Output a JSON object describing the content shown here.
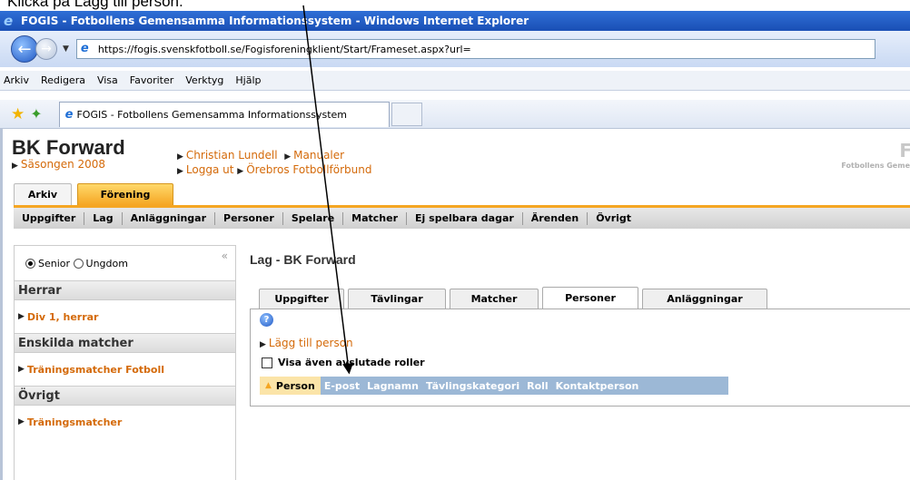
{
  "caption": "Klicka på Lägg till person.",
  "window": {
    "title": "FOGIS - Fotbollens Gemensamma Informationssystem - Windows Internet Explorer",
    "url": "https://fogis.svenskfotboll.se/Fogisforeningklient/Start/Frameset.aspx?url="
  },
  "menu": [
    "Arkiv",
    "Redigera",
    "Visa",
    "Favoriter",
    "Verktyg",
    "Hjälp"
  ],
  "browser_tab": {
    "title": "FOGIS - Fotbollens Gemensamma Informationssystem"
  },
  "header": {
    "org_name": "BK Forward",
    "season": "Säsongen 2008",
    "user": "Christian Lundell",
    "manuals": "Manualer",
    "logout": "Logga ut",
    "district": "Örebros Fotbollförbund",
    "brand_letter": "F",
    "brand_sub": "Fotbollens Geme"
  },
  "top_tabs": [
    "Arkiv",
    "Förening"
  ],
  "subnav": [
    "Uppgifter",
    "Lag",
    "Anläggningar",
    "Personer",
    "Spelare",
    "Matcher",
    "Ej spelbara dagar",
    "Ärenden",
    "Övrigt"
  ],
  "sidebar": {
    "radio_senior": "Senior",
    "radio_youth": "Ungdom",
    "groups": [
      {
        "title": "Herrar",
        "items": [
          "Div 1, herrar"
        ]
      },
      {
        "title": "Enskilda matcher",
        "items": [
          "Träningsmatcher Fotboll"
        ]
      },
      {
        "title": "Övrigt",
        "items": [
          "Träningsmatcher"
        ]
      }
    ]
  },
  "main": {
    "title": "Lag - BK Forward",
    "tabs": [
      "Uppgifter",
      "Tävlingar",
      "Matcher",
      "Personer",
      "Anläggningar"
    ],
    "add_person": "Lägg till person",
    "show_ended": "Visa även avslutade roller",
    "columns": [
      "Person",
      "E-post",
      "Lagnamn",
      "Tävlingskategori",
      "Roll",
      "Kontaktperson"
    ]
  }
}
